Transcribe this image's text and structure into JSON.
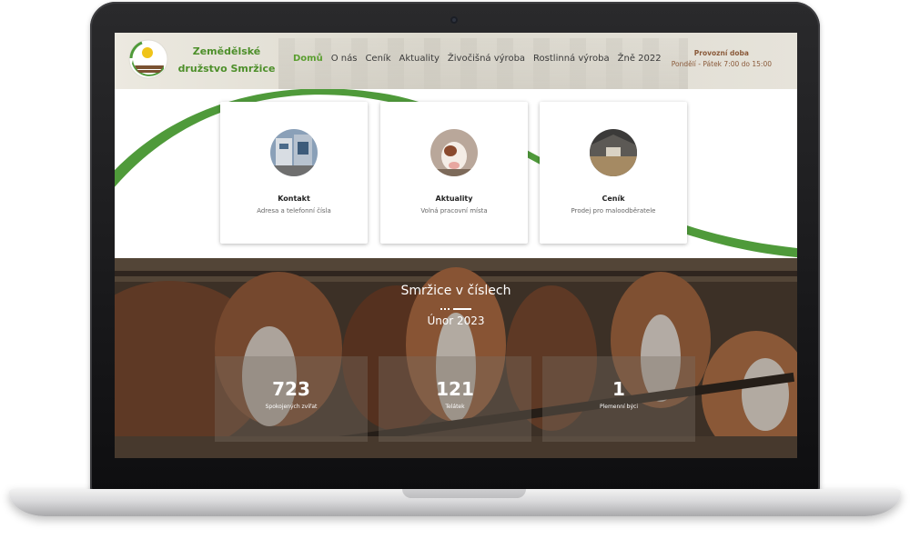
{
  "header": {
    "brand_line1": "Zemědělské",
    "brand_line2": "družstvo Smržice",
    "nav": [
      "Domů",
      "O nás",
      "Ceník",
      "Aktuality",
      "Živočišná výroba",
      "Rostlinná výroba",
      "Žně 2022"
    ],
    "active_nav": "Domů",
    "hours_title": "Provozní doba",
    "hours_value": "Pondělí - Pátek 7:00 do 15:00"
  },
  "cards": [
    {
      "title": "Kontakt",
      "subtitle": "Adresa a telefonní čísla",
      "icon": "building-photo"
    },
    {
      "title": "Aktuality",
      "subtitle": "Volná pracovní místa",
      "icon": "calf-photo"
    },
    {
      "title": "Ceník",
      "subtitle": "Prodej pro maloodběratele",
      "icon": "barn-photo"
    }
  ],
  "stats": {
    "title": "Smržice v číslech",
    "month": "Únor 2023",
    "items": [
      {
        "value": "723",
        "label": "Spokojených zvířat"
      },
      {
        "value": "121",
        "label": "Telátek"
      },
      {
        "value": "1",
        "label": "Plemenní býci"
      }
    ]
  },
  "colors": {
    "accent_green": "#5a9e2f",
    "swoosh_green": "#4f9a3a",
    "hours_brown": "#8a5a3a"
  }
}
